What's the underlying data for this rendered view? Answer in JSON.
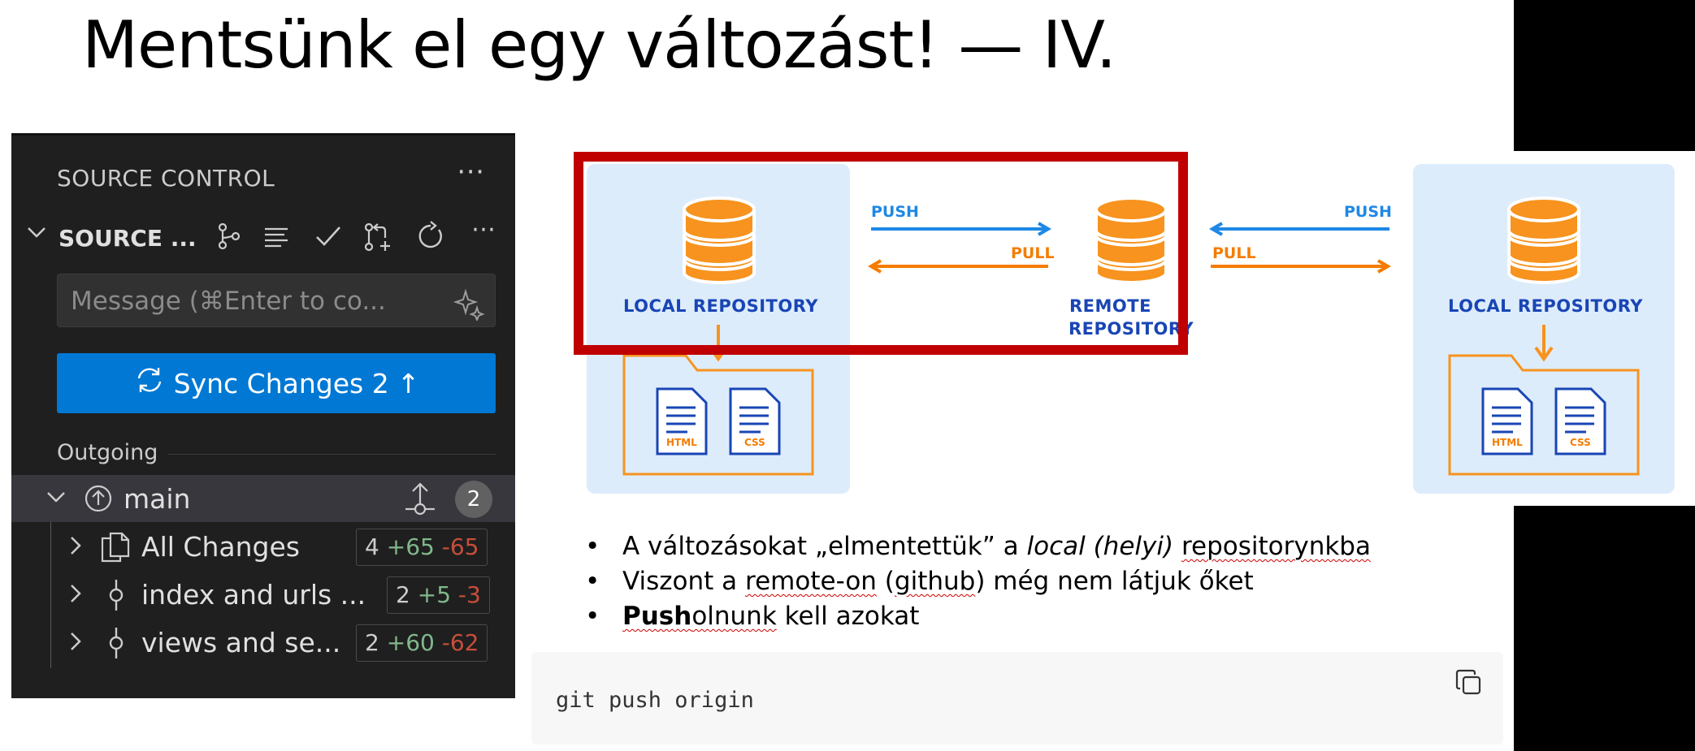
{
  "slide": {
    "title": "Mentsünk el egy változást! — IV."
  },
  "source_control": {
    "header_title": "SOURCE CONTROL",
    "more_actions": "⋯",
    "section_label": "SOURCE ...",
    "toolbar_icons": [
      "branch-graph-icon",
      "list-icon",
      "commit-check-icon",
      "pull-request-icon",
      "refresh-icon",
      "more-icon"
    ],
    "message_placeholder": "Message (⌘Enter to co...",
    "sync_button": {
      "label": "Sync Changes 2",
      "arrow": "↑"
    },
    "outgoing_label": "Outgoing",
    "branch": {
      "name": "main",
      "count": "2"
    },
    "changes": [
      {
        "label": "All Changes",
        "icon": "files-icon",
        "count": "4",
        "plus": "+65",
        "minus": "-65"
      },
      {
        "label": "index and urls ...",
        "icon": "commit-icon",
        "count": "2",
        "plus": "+5",
        "minus": "-3"
      },
      {
        "label": "views and se...",
        "icon": "commit-icon",
        "count": "2",
        "plus": "+60",
        "minus": "-62"
      }
    ]
  },
  "diagram": {
    "left_repo_label": "LOCAL REPOSITORY",
    "remote_repo_label_line1": "REMOTE",
    "remote_repo_label_line2": "REPOSITORY",
    "right_repo_label": "LOCAL REPOSITORY",
    "push_label": "PUSH",
    "pull_label": "PULL",
    "file_html": "HTML",
    "file_css": "CSS",
    "colors": {
      "push": "#1e88e5",
      "pull": "#f57c00",
      "database": "#f7931e",
      "card": "#ddecfb",
      "highlight": "#c00000"
    }
  },
  "bullets": {
    "b1_part1": "A változásokat „elmentettük” a ",
    "b1_italic": "local (helyi)",
    "b1_space": " ",
    "b1_underlined": "repositorynkba",
    "b2_part1": "Viszont a ",
    "b2_underlined1": "remote-on",
    "b2_part2": " (",
    "b2_underlined2": "github",
    "b2_part3": ") még nem látjuk őket",
    "b3_bold": "Push",
    "b3_underlined_rest": "olnunk",
    "b3_part2": " kell azokat"
  },
  "code_block": {
    "code": "git push origin"
  }
}
